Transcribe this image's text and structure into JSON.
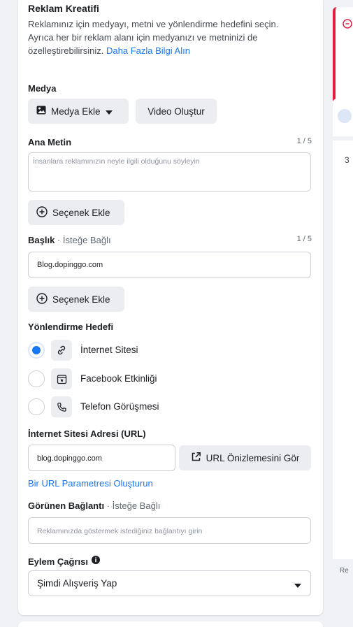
{
  "creative": {
    "title": "Reklam Kreatifi",
    "desc_line1": "Reklamınız için medyayı, metni ve yönlendirme hedefini seçin.",
    "desc_line2": "Ayrıca her bir reklam alanı için medyanızı ve metninizi de",
    "desc_line3_text": "özelleştirebilirsiniz.",
    "learn_more": "Daha Fazla Bilgi Alın"
  },
  "media": {
    "title": "Medya",
    "add_media": "Medya Ekle",
    "create_video": "Video Oluştur"
  },
  "primary_text": {
    "title": "Ana Metin",
    "counter": "1 / 5",
    "placeholder": "İnsanlara reklamınızın neyle ilgili olduğunu söyleyin",
    "add_option": "Seçenek Ekle"
  },
  "headline": {
    "title": "Başlık",
    "optional": "İsteğe Bağlı",
    "separator": "·",
    "counter": "1 / 5",
    "value": "Blog.dopinggo.com",
    "add_option": "Seçenek Ekle"
  },
  "destination": {
    "title": "Yönlendirme Hedefi",
    "options": [
      {
        "label": "İnternet Sitesi",
        "icon": "link-icon",
        "selected": true
      },
      {
        "label": "Facebook Etkinliği",
        "icon": "calendar-icon",
        "selected": false
      },
      {
        "label": "Telefon Görüşmesi",
        "icon": "phone-icon",
        "selected": false
      }
    ]
  },
  "website_url": {
    "title": "İnternet Sitesi Adresi (URL)",
    "value": "blog.dopinggo.com",
    "preview_button": "URL Önizlemesini Gör",
    "param_link": "Bir URL Parametresi Oluşturun"
  },
  "display_link": {
    "title": "Görünen Bağlantı",
    "optional": "İsteğe Bağlı",
    "separator": "·",
    "placeholder": "Reklamınızda göstermek istediğiniz bağlantıyı girin"
  },
  "cta": {
    "title": "Eylem Çağrısı",
    "selected": "Şimdi Alışveriş Yap"
  },
  "right_panel": {
    "digit": "3",
    "footer_text": "Re"
  },
  "colors": {
    "accent": "#1877f2",
    "error": "#e41e3f"
  }
}
